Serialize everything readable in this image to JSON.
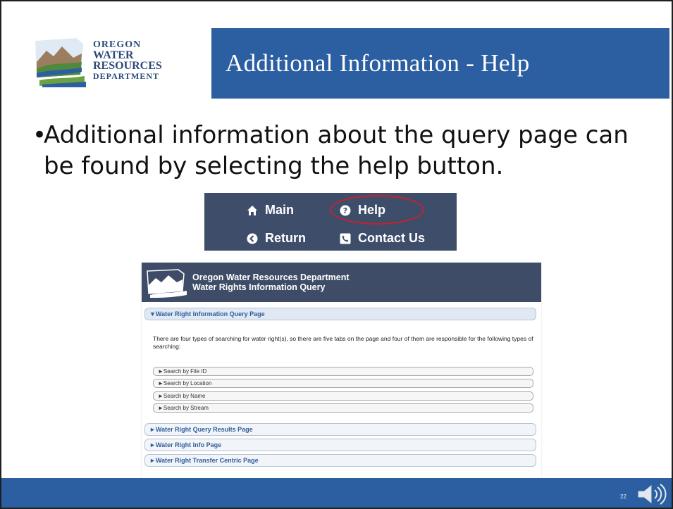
{
  "logo": {
    "line1": "OREGON",
    "line2": "WATER",
    "line3": "RESOURCES",
    "line4": "DEPARTMENT"
  },
  "title": "Additional Information - Help",
  "bullet": "Additional information about the query page can be found by selecting the help button.",
  "nav": {
    "main": "Main",
    "help": "Help",
    "return": "Return",
    "contact": "Contact Us"
  },
  "screenshot": {
    "header_line1": "Oregon Water Resources Department",
    "header_line2": "Water Rights Information Query",
    "section_open": "▼Water Right Information Query Page",
    "paragraph": "There are four types of searching for water right(s), so there are five tabs on the page and four of them are responsible for the following types of searching:",
    "sub_items": [
      "►Search by File ID",
      "►Search by Location",
      "►Search by Name",
      "►Search by Stream"
    ],
    "sections": [
      "►Water Right Query Results Page",
      "►Water Right Info Page",
      "►Water Right Transfer Centric Page"
    ]
  },
  "page_number": "22",
  "colors": {
    "title_bg": "#2c5fa2",
    "nav_bg": "#3e4e6a",
    "highlight_ring": "#c8202e"
  },
  "icons": [
    "home-icon",
    "question-circle-icon",
    "back-circle-icon",
    "phone-icon",
    "speaker-icon"
  ]
}
